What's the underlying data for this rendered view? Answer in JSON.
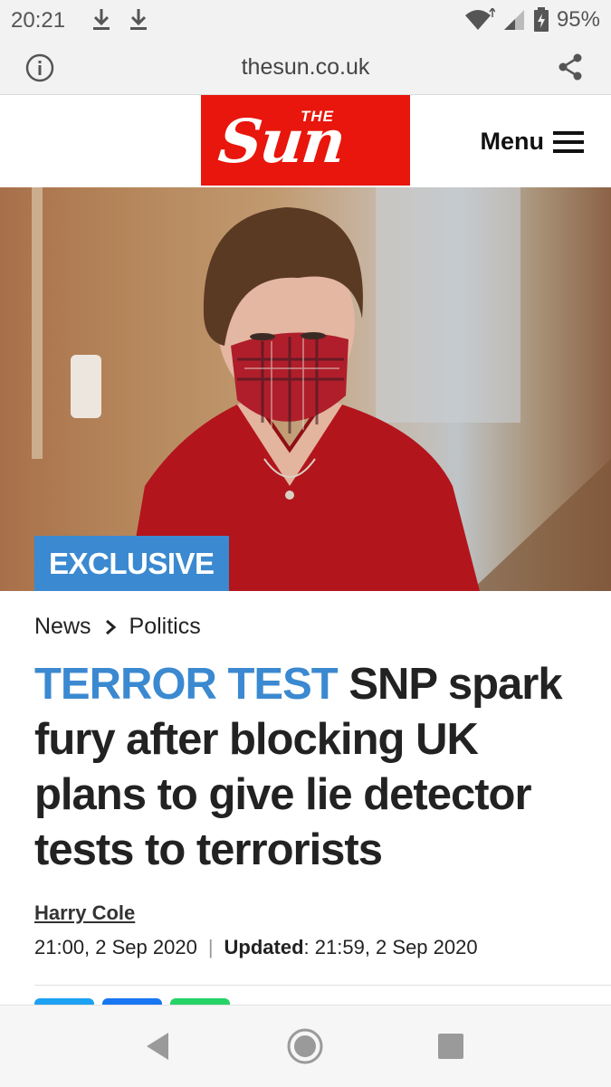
{
  "status_bar": {
    "time": "20:21",
    "battery": "95%",
    "icons": [
      "download-icon",
      "download-icon",
      "wifi-icon",
      "signal-icon",
      "battery-icon"
    ]
  },
  "browser": {
    "url": "thesun.co.uk",
    "icons": [
      "info-icon",
      "share-icon"
    ]
  },
  "header": {
    "logo_small": "THE",
    "logo_main": "Sun",
    "menu_label": "Menu",
    "brand_color": "#e8160c"
  },
  "hero": {
    "badge": "EXCLUSIVE",
    "badge_color": "#3b89d0"
  },
  "article": {
    "breadcrumb": [
      "News",
      "Politics"
    ],
    "kicker": "TERROR TEST",
    "headline": "SNP spark fury after blocking UK plans to give lie detector tests to terrorists",
    "author": "Harry Cole",
    "published": "21:00, 2 Sep 2020",
    "updated_label": "Updated",
    "updated_value": ": 21:59, 2 Sep 2020"
  },
  "share_colors": [
    "#1da1f2",
    "#1877f2",
    "#25d366"
  ],
  "nav_bar": {
    "icons": [
      "back-icon",
      "home-icon",
      "recent-apps-icon"
    ]
  }
}
